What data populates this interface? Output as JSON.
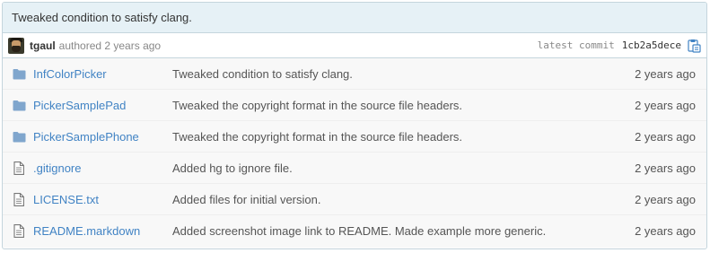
{
  "commit": {
    "title": "Tweaked condition to satisfy clang.",
    "author": "tgaul",
    "authored_text": "authored 2 years ago",
    "latest_label": "latest commit",
    "sha": "1cb2a5dece"
  },
  "colors": {
    "link": "#4183c4",
    "folder": "#80a6cd",
    "header_bg": "#e6f1f6",
    "border": "#c5d5dd"
  },
  "files": [
    {
      "type": "directory",
      "icon": "folder-icon",
      "name": "InfColorPicker",
      "message": "Tweaked condition to satisfy clang.",
      "age": "2 years ago"
    },
    {
      "type": "directory",
      "icon": "folder-icon",
      "name": "PickerSamplePad",
      "message": "Tweaked the copyright format in the source file headers.",
      "age": "2 years ago"
    },
    {
      "type": "directory",
      "icon": "folder-icon",
      "name": "PickerSamplePhone",
      "message": "Tweaked the copyright format in the source file headers.",
      "age": "2 years ago"
    },
    {
      "type": "file",
      "icon": "file-icon",
      "name": ".gitignore",
      "message": "Added hg to ignore file.",
      "age": "2 years ago"
    },
    {
      "type": "file",
      "icon": "file-icon",
      "name": "LICENSE.txt",
      "message": "Added files for initial version.",
      "age": "2 years ago"
    },
    {
      "type": "file",
      "icon": "file-icon",
      "name": "README.markdown",
      "message": "Added screenshot image link to README. Made example more generic.",
      "age": "2 years ago"
    }
  ]
}
